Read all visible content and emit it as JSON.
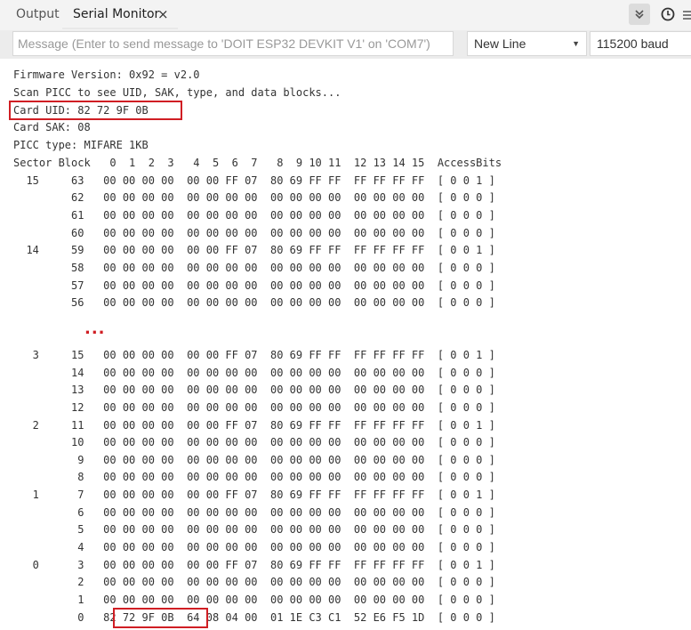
{
  "tabs": {
    "output": "Output",
    "serial_monitor": "Serial Monitor",
    "close": "×"
  },
  "toolbar": {
    "autoscroll_icon": "double-chevron-down-icon",
    "timestamp_icon": "clock-icon",
    "menu_icon": "menu-icon"
  },
  "input": {
    "message_placeholder": "Message (Enter to send message to 'DOIT ESP32 DEVKIT V1' on 'COM7')",
    "line_ending": "New Line",
    "baud": "115200 baud"
  },
  "colors": {
    "highlight": "#d01e24",
    "tabbar_bg": "#f3f3f3",
    "inputbar_bg": "#ececec"
  },
  "ellipsis": "...",
  "header_lines": [
    "Firmware Version: 0x92 = v2.0",
    "Scan PICC to see UID, SAK, type, and data blocks...",
    "Card UID: 82 72 9F 0B",
    "Card SAK: 08",
    "PICC type: MIFARE 1KB",
    "Sector Block   0  1  2  3   4  5  6  7   8  9 10 11  12 13 14 15  AccessBits"
  ],
  "dump_top": [
    "  15     63   00 00 00 00  00 00 FF 07  80 69 FF FF  FF FF FF FF  [ 0 0 1 ]",
    "         62   00 00 00 00  00 00 00 00  00 00 00 00  00 00 00 00  [ 0 0 0 ]",
    "         61   00 00 00 00  00 00 00 00  00 00 00 00  00 00 00 00  [ 0 0 0 ]",
    "         60   00 00 00 00  00 00 00 00  00 00 00 00  00 00 00 00  [ 0 0 0 ]",
    "  14     59   00 00 00 00  00 00 FF 07  80 69 FF FF  FF FF FF FF  [ 0 0 1 ]",
    "         58   00 00 00 00  00 00 00 00  00 00 00 00  00 00 00 00  [ 0 0 0 ]",
    "         57   00 00 00 00  00 00 00 00  00 00 00 00  00 00 00 00  [ 0 0 0 ]",
    "         56   00 00 00 00  00 00 00 00  00 00 00 00  00 00 00 00  [ 0 0 0 ]"
  ],
  "dump_bottom": [
    "   3     15   00 00 00 00  00 00 FF 07  80 69 FF FF  FF FF FF FF  [ 0 0 1 ]",
    "         14   00 00 00 00  00 00 00 00  00 00 00 00  00 00 00 00  [ 0 0 0 ]",
    "         13   00 00 00 00  00 00 00 00  00 00 00 00  00 00 00 00  [ 0 0 0 ]",
    "         12   00 00 00 00  00 00 00 00  00 00 00 00  00 00 00 00  [ 0 0 0 ]",
    "   2     11   00 00 00 00  00 00 FF 07  80 69 FF FF  FF FF FF FF  [ 0 0 1 ]",
    "         10   00 00 00 00  00 00 00 00  00 00 00 00  00 00 00 00  [ 0 0 0 ]",
    "          9   00 00 00 00  00 00 00 00  00 00 00 00  00 00 00 00  [ 0 0 0 ]",
    "          8   00 00 00 00  00 00 00 00  00 00 00 00  00 00 00 00  [ 0 0 0 ]",
    "   1      7   00 00 00 00  00 00 FF 07  80 69 FF FF  FF FF FF FF  [ 0 0 1 ]",
    "          6   00 00 00 00  00 00 00 00  00 00 00 00  00 00 00 00  [ 0 0 0 ]",
    "          5   00 00 00 00  00 00 00 00  00 00 00 00  00 00 00 00  [ 0 0 0 ]",
    "          4   00 00 00 00  00 00 00 00  00 00 00 00  00 00 00 00  [ 0 0 0 ]",
    "   0      3   00 00 00 00  00 00 FF 07  80 69 FF FF  FF FF FF FF  [ 0 0 1 ]",
    "          2   00 00 00 00  00 00 00 00  00 00 00 00  00 00 00 00  [ 0 0 0 ]",
    "          1   00 00 00 00  00 00 00 00  00 00 00 00  00 00 00 00  [ 0 0 0 ]",
    "          0   82 72 9F 0B  64 08 04 00  01 1E C3 C1  52 E6 F5 1D  [ 0 0 0 ]"
  ]
}
